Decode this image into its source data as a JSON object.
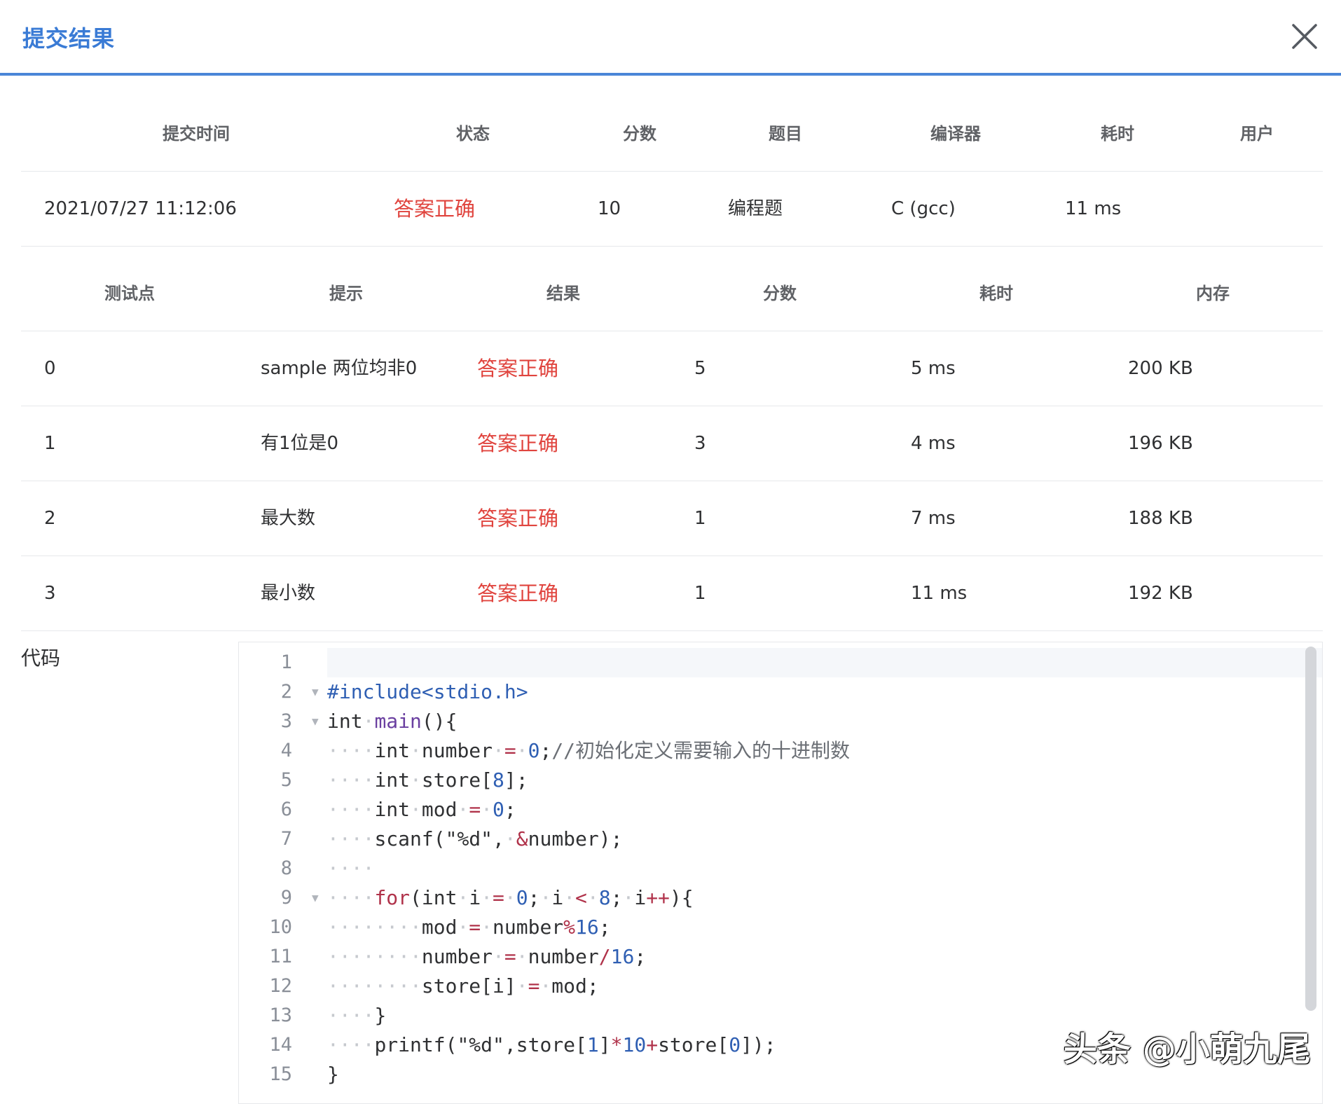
{
  "dialog": {
    "title": "提交结果",
    "close_icon": "close-icon"
  },
  "summary": {
    "headers": [
      "提交时间",
      "状态",
      "分数",
      "题目",
      "编译器",
      "耗时",
      "用户"
    ],
    "row": {
      "time": "2021/07/27 11:12:06",
      "status": "答案正确",
      "score": "10",
      "problem": "编程题",
      "compiler": "C (gcc)",
      "duration": "11 ms",
      "user": ""
    }
  },
  "testcases": {
    "headers": [
      "测试点",
      "提示",
      "结果",
      "分数",
      "耗时",
      "内存"
    ],
    "rows": [
      {
        "id": "0",
        "hint": "sample 两位均非0",
        "result": "答案正确",
        "score": "5",
        "time": "5 ms",
        "memory": "200 KB"
      },
      {
        "id": "1",
        "hint": "有1位是0",
        "result": "答案正确",
        "score": "3",
        "time": "4 ms",
        "memory": "196 KB"
      },
      {
        "id": "2",
        "hint": "最大数",
        "result": "答案正确",
        "score": "1",
        "time": "7 ms",
        "memory": "188 KB"
      },
      {
        "id": "3",
        "hint": "最小数",
        "result": "答案正确",
        "score": "1",
        "time": "11 ms",
        "memory": "192 KB"
      }
    ]
  },
  "code": {
    "label": "代码",
    "lines": [
      "",
      "#include<stdio.h>",
      "int main(){",
      "    int number = 0;//初始化定义需要输入的十进制数",
      "    int store[8];",
      "    int mod = 0;",
      "    scanf(\"%d\", &number);",
      "    ",
      "    for(int i = 0; i < 8; i++){",
      "        mod = number%16;",
      "        number = number/16;",
      "        store[i] = mod;",
      "    }",
      "    printf(\"%d\",store[1]*10+store[0]);",
      "}"
    ],
    "line_numbers": [
      "1",
      "2",
      "3",
      "4",
      "5",
      "6",
      "7",
      "8",
      "9",
      "10",
      "11",
      "12",
      "13",
      "14",
      "15"
    ]
  },
  "watermark": "头条 @小萌九尾",
  "colors": {
    "accent": "#3a7bd5",
    "success_text": "#e0443e",
    "border": "#e6e8eb"
  }
}
